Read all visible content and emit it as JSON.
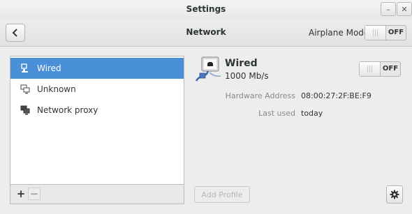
{
  "window": {
    "title": "Settings"
  },
  "header": {
    "title": "Network",
    "airplane_mode": {
      "label": "Airplane Mode",
      "state": "OFF"
    }
  },
  "sidebar": {
    "items": [
      {
        "label": "Wired",
        "icon": "wired-network-icon",
        "selected": true
      },
      {
        "label": "Unknown",
        "icon": "network-icon",
        "selected": false
      },
      {
        "label": "Network proxy",
        "icon": "network-proxy-icon",
        "selected": false
      }
    ],
    "toolbar": {
      "add": "+",
      "remove": "−"
    }
  },
  "detail": {
    "name": "Wired",
    "speed": "1000 Mb/s",
    "switch_state": "OFF",
    "rows": [
      {
        "label": "Hardware Address",
        "value": "08:00:27:2F:BE:F9"
      },
      {
        "label": "Last used",
        "value": "today"
      }
    ],
    "add_profile_label": "Add Profile"
  },
  "colors": {
    "accent": "#4a90d9",
    "background": "#ededed"
  }
}
